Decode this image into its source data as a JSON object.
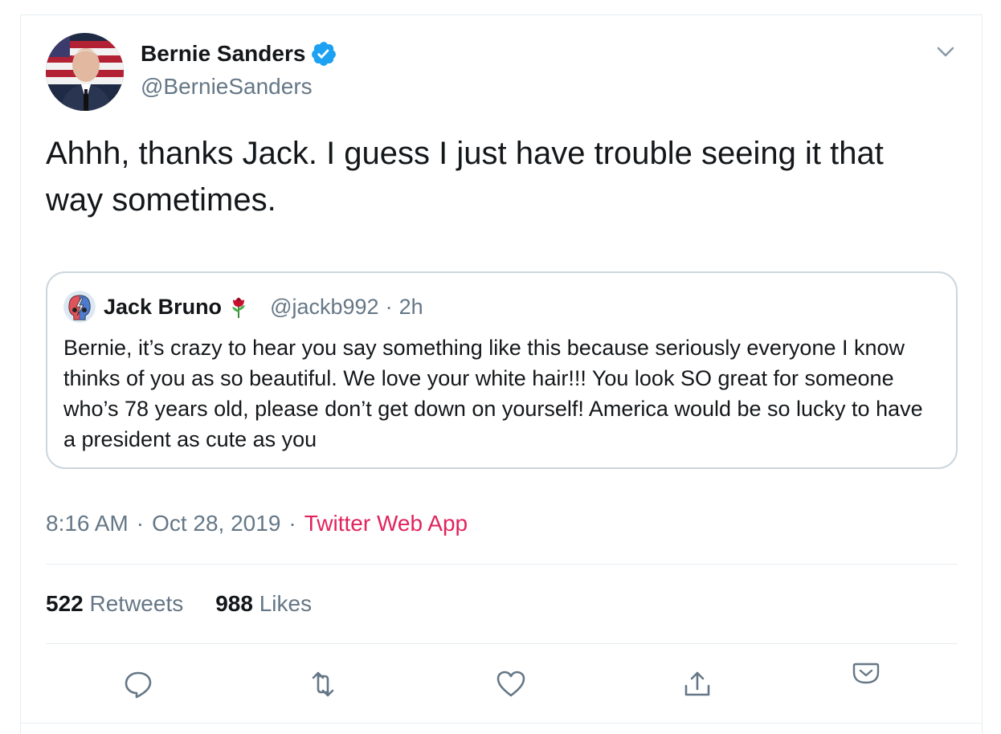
{
  "author": {
    "display_name": "Bernie Sanders",
    "handle": "@BernieSanders",
    "verified": true
  },
  "tweet": {
    "text": "Ahhh, thanks Jack. I guess I just have trouble seeing it that way sometimes."
  },
  "quoted": {
    "name": "Jack Bruno",
    "handle": "@jackb992",
    "separator": "·",
    "time": "2h",
    "text": "Bernie, it’s crazy to hear you say something like this because seriously everyone I know thinks of you as so beautiful. We love your white hair!!! You look SO great for someone who’s 78 years old, please don’t get down on yourself! America would be so lucky to have a president as cute as you"
  },
  "meta": {
    "time": "8:16 AM",
    "separator": "·",
    "date": "Oct 28, 2019",
    "source": "Twitter Web App"
  },
  "stats": {
    "retweets_count": "522",
    "retweets_label": "Retweets",
    "likes_count": "988",
    "likes_label": "Likes"
  },
  "icons": {
    "reply": "reply-icon",
    "retweet": "retweet-icon",
    "like": "heart-icon",
    "share": "share-icon",
    "extra": "pocket-icon"
  },
  "colors": {
    "text": "#14171a",
    "secondary": "#657786",
    "source_link": "#e0245e",
    "verified": "#1da1f2",
    "border": "#e6ecf0"
  }
}
